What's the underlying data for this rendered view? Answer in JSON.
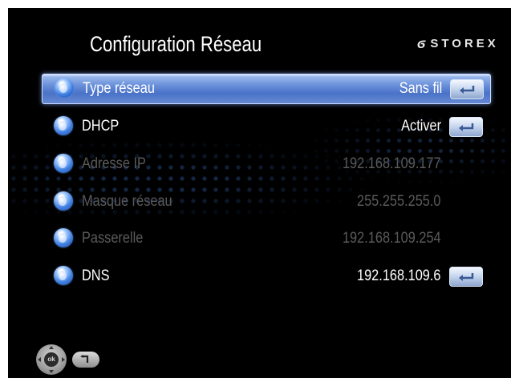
{
  "screen": {
    "title": "Configuration Réseau",
    "brand": "STOREX",
    "brand_logo": "storex-logo-icon"
  },
  "menu": {
    "items": [
      {
        "label": "Type réseau",
        "value": "Sans fil",
        "enabled": true,
        "selected": true,
        "has_enter": true
      },
      {
        "label": "DHCP",
        "value": "Activer",
        "enabled": true,
        "selected": false,
        "has_enter": true
      },
      {
        "label": "Adresse IP",
        "value": "192.168.109.177",
        "enabled": false,
        "selected": false,
        "has_enter": false
      },
      {
        "label": "Masque réseau",
        "value": "255.255.255.0",
        "enabled": false,
        "selected": false,
        "has_enter": false
      },
      {
        "label": "Passerelle",
        "value": "192.168.109.254",
        "enabled": false,
        "selected": false,
        "has_enter": false
      },
      {
        "label": "DNS",
        "value": "192.168.109.6",
        "enabled": true,
        "selected": false,
        "has_enter": true
      }
    ]
  },
  "footer": {
    "navpad_label": "ok",
    "navpad_icon": "dpad-icon",
    "back_icon": "back-icon"
  },
  "colors": {
    "selected_highlight": "#5b82d3",
    "disabled_text": "#5a5a5a",
    "text": "#ffffff",
    "background": "#000000"
  }
}
